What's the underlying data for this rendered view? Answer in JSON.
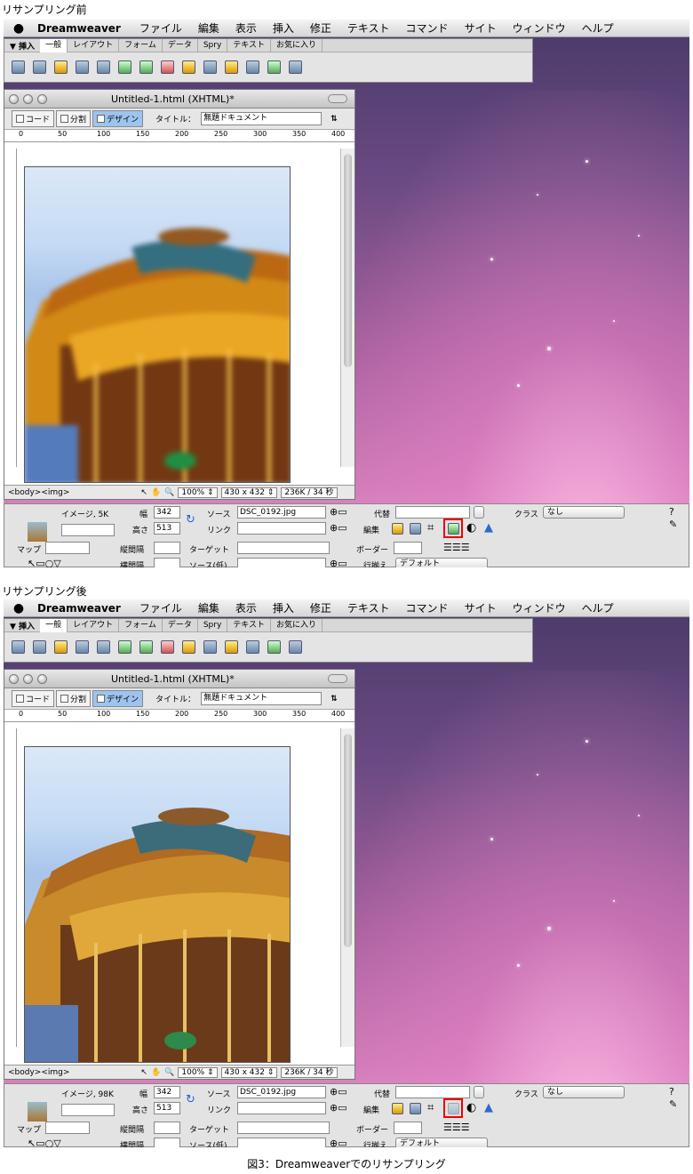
{
  "labels": {
    "before": "リサンプリング前",
    "after": "リサンプリング後",
    "caption": "図3：Dreamweaverでのリサンプリング"
  },
  "menubar": {
    "app": "Dreamweaver",
    "items": [
      "ファイル",
      "編集",
      "表示",
      "挿入",
      "修正",
      "テキスト",
      "コマンド",
      "サイト",
      "ウィンドウ",
      "ヘルプ"
    ]
  },
  "insert_panel": {
    "header": "▼ 挿入",
    "tabs": [
      "一般",
      "レイアウト",
      "フォーム",
      "データ",
      "Spry",
      "テキスト",
      "お気に入り"
    ]
  },
  "document": {
    "title": "Untitled-1.html (XHTML)*",
    "view_code": "コード",
    "view_split": "分割",
    "view_design": "デザイン",
    "title_label": "タイトル：",
    "title_value": "無題ドキュメント",
    "ruler_ticks": [
      "0",
      "50",
      "100",
      "150",
      "200",
      "250",
      "300",
      "350",
      "400"
    ],
    "vruler_ticks": [
      "0",
      "5",
      "1",
      "1",
      "2",
      "2",
      "3",
      "3",
      "4",
      "4",
      "5"
    ]
  },
  "status": {
    "tags": "<body><img>",
    "zoom": "100% ⇕",
    "size": "430 x 432 ⇕",
    "download": "236K / 34 秒"
  },
  "props_before": {
    "image_info": "イメージ, 5K",
    "width_label": "幅",
    "width_value": "342",
    "height_label": "高さ",
    "height_value": "513",
    "src_label": "ソース",
    "src_value": "DSC_0192.jpg",
    "link_label": "リンク",
    "alt_label": "代替",
    "edit_label": "編集",
    "class_label": "クラス",
    "class_value": "なし",
    "map_label": "マップ",
    "vspace_label": "縦間隔",
    "target_label": "ターゲット",
    "border_label": "ボーダー",
    "hspace_label": "横間隔",
    "lowsrc_label": "ソース(低)",
    "align_label": "行揃え",
    "align_value": "デフォルト"
  },
  "props_after": {
    "image_info": "イメージ, 98K",
    "width_label": "幅",
    "width_value": "342",
    "height_label": "高さ",
    "height_value": "513",
    "src_label": "ソース",
    "src_value": "DSC_0192.jpg",
    "link_label": "リンク",
    "alt_label": "代替",
    "edit_label": "編集",
    "class_label": "クラス",
    "class_value": "なし",
    "map_label": "マップ",
    "vspace_label": "縦間隔",
    "target_label": "ターゲット",
    "border_label": "ボーダー",
    "hspace_label": "横間隔",
    "lowsrc_label": "ソース(低)",
    "align_label": "行揃え",
    "align_value": "デフォルト"
  },
  "colors": {
    "highlight": "#e00000",
    "desktop_top": "#4a3a6a",
    "desktop_bottom": "#e8a0cf"
  }
}
